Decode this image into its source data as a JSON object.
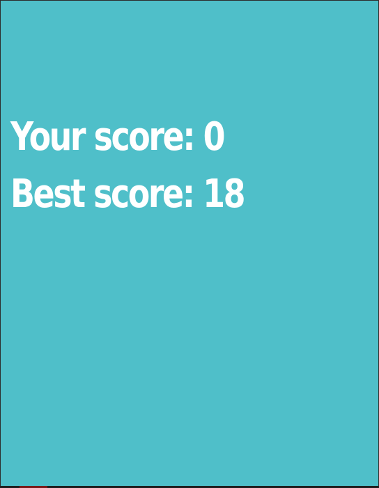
{
  "game": {
    "your_score_label": "Your score:",
    "your_score_value": "0",
    "best_score_label": "Best score:",
    "best_score_value": "18",
    "background_color": "#4fbfc9",
    "text_color": "#ffffff"
  }
}
